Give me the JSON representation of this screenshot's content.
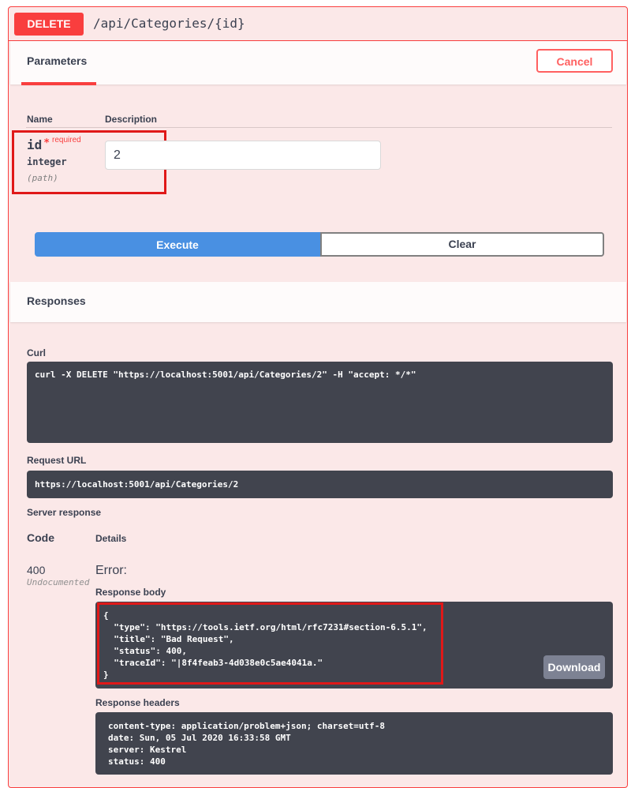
{
  "operation": {
    "method": "DELETE",
    "path": "/api/Categories/{id}"
  },
  "parameters": {
    "tab_label": "Parameters",
    "cancel_label": "Cancel",
    "col_name": "Name",
    "col_description": "Description",
    "param": {
      "name": "id",
      "required_star": "*",
      "required_label": "required",
      "type": "integer",
      "in": "(path)",
      "value": "2"
    }
  },
  "actions": {
    "execute_label": "Execute",
    "clear_label": "Clear"
  },
  "responses": {
    "title": "Responses",
    "curl_label": "Curl",
    "curl_text": "curl -X DELETE \"https://localhost:5001/api/Categories/2\" -H \"accept: */*\"",
    "request_url_label": "Request URL",
    "request_url": "https://localhost:5001/api/Categories/2",
    "server_response_label": "Server response",
    "code_head": "Code",
    "details_head": "Details",
    "code": "400",
    "code_note": "Undocumented",
    "error_label": "Error:",
    "response_body_label": "Response body",
    "response_body": "{\n  \"type\": \"https://tools.ietf.org/html/rfc7231#section-6.5.1\",\n  \"title\": \"Bad Request\",\n  \"status\": 400,\n  \"traceId\": \"|8f4feab3-4d038e0c5ae4041a.\"\n}",
    "download_label": "Download",
    "response_headers_label": "Response headers",
    "response_headers": "content-type: application/problem+json; charset=utf-8\ndate: Sun, 05 Jul 2020 16:33:58 GMT\nserver: Kestrel\nstatus: 400"
  },
  "colors": {
    "delete_red": "#f93e3e",
    "execute_blue": "#4990e2",
    "code_bg": "#41444e",
    "highlight": "#e01818"
  }
}
